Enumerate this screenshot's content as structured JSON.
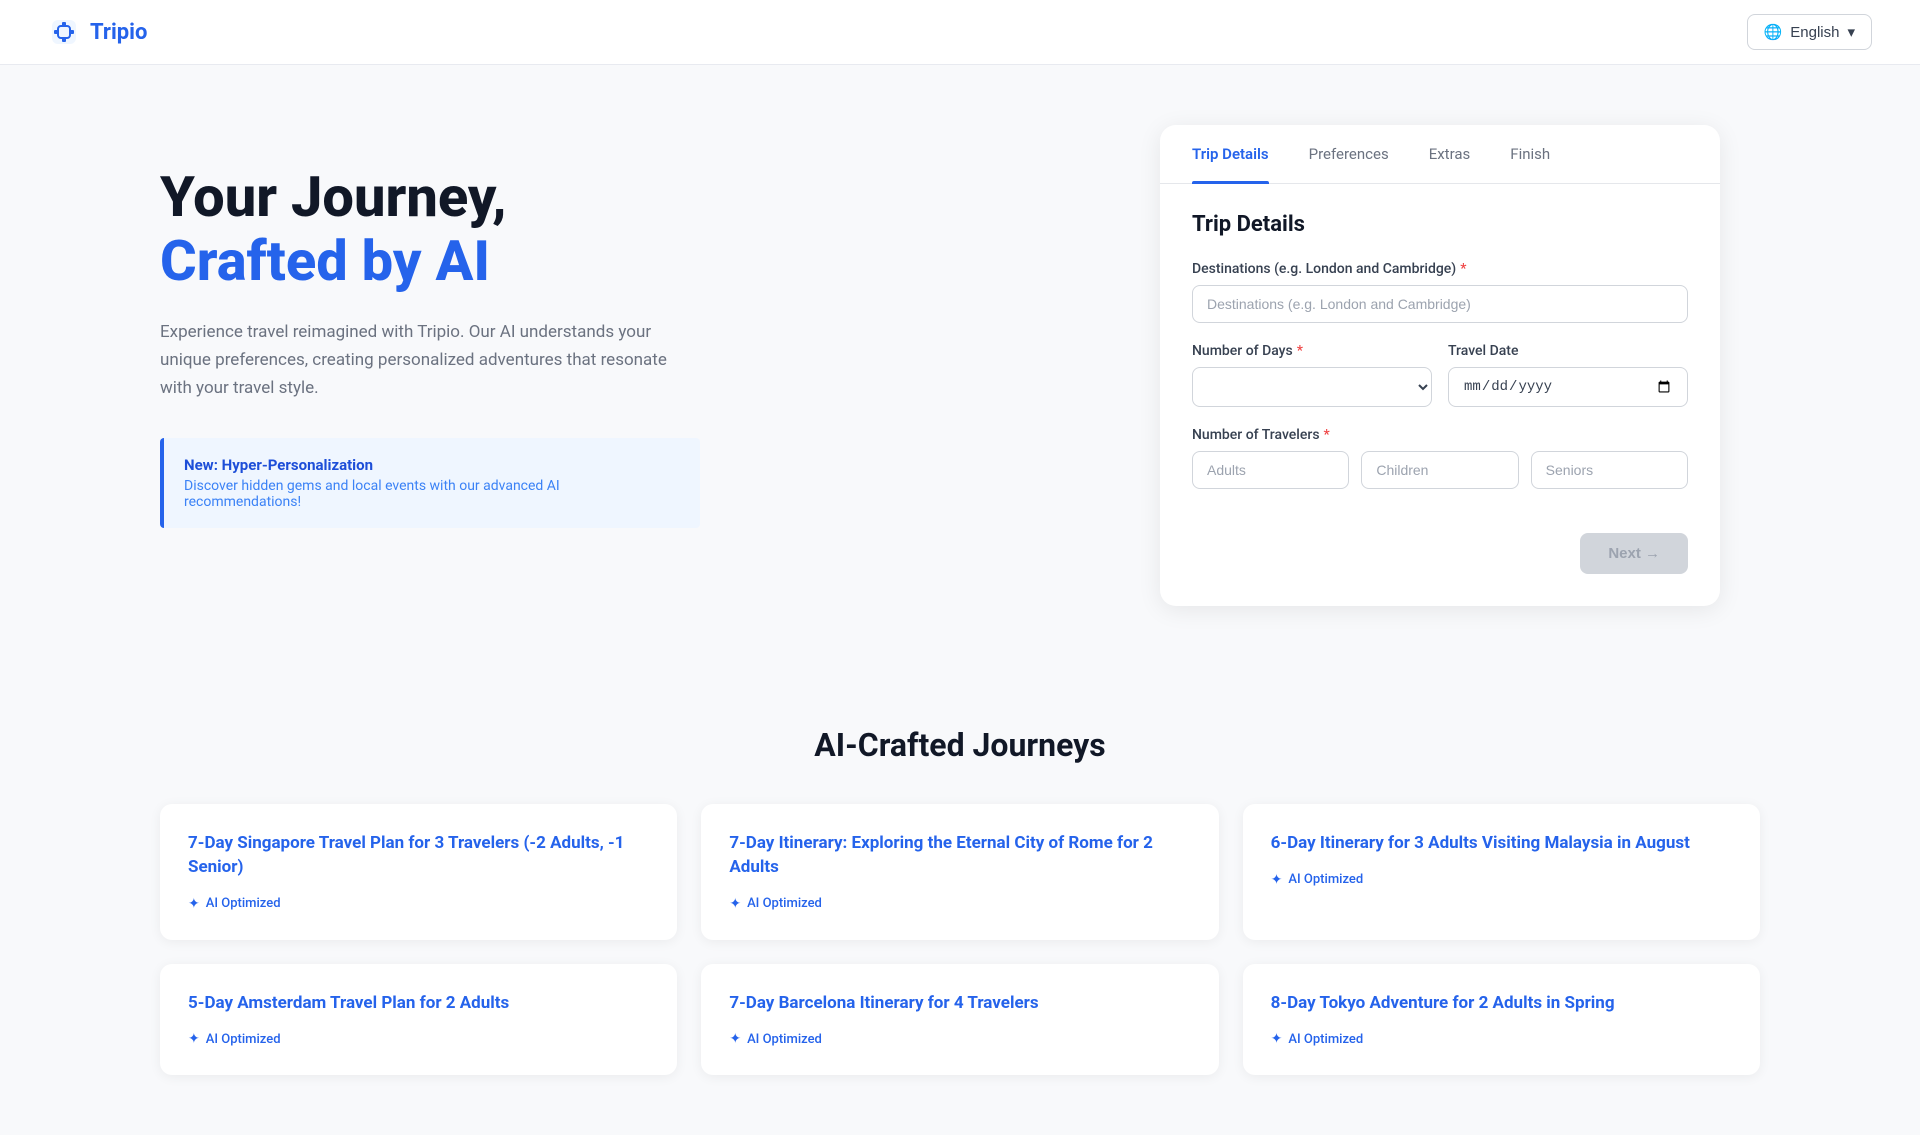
{
  "header": {
    "logo_text": "Tripio",
    "lang_label": "English",
    "lang_icon": "🌐"
  },
  "hero": {
    "title_line1": "Your Journey,",
    "title_line2": "Crafted by AI",
    "description": "Experience travel reimagined with Tripio. Our AI understands your unique preferences, creating personalized adventures that resonate with your travel style.",
    "promo_title": "New: Hyper-Personalization",
    "promo_desc": "Discover hidden gems and local events with our advanced AI recommendations!"
  },
  "trip_form": {
    "section_title": "Trip Details",
    "tabs": [
      {
        "id": "trip-details",
        "label": "Trip Details",
        "active": true
      },
      {
        "id": "preferences",
        "label": "Preferences",
        "active": false
      },
      {
        "id": "extras",
        "label": "Extras",
        "active": false
      },
      {
        "id": "finish",
        "label": "Finish",
        "active": false
      }
    ],
    "fields": {
      "destinations_label": "Destinations (e.g. London and Cambridge)",
      "destinations_placeholder": "Destinations (e.g. London and Cambridge)",
      "num_days_label": "Number of Days",
      "travel_date_label": "Travel Date",
      "travel_date_placeholder": "mm/dd/yyyy",
      "travelers_label": "Number of Travelers",
      "adults_placeholder": "Adults",
      "children_placeholder": "Children",
      "seniors_placeholder": "Seniors"
    },
    "next_button": "Next →"
  },
  "journeys": {
    "section_title": "AI-Crafted Journeys",
    "ai_badge_label": "AI Optimized",
    "cards": [
      {
        "title": "7-Day Singapore Travel Plan for 3 Travelers (-2 Adults, -1 Senior)",
        "badge": "AI Optimized"
      },
      {
        "title": "7-Day Itinerary: Exploring the Eternal City of Rome for 2 Adults",
        "badge": "AI Optimized"
      },
      {
        "title": "6-Day Itinerary for 3 Adults Visiting Malaysia in August",
        "badge": "AI Optimized"
      },
      {
        "title": "5-Day Amsterdam Travel Plan for 2 Adults",
        "badge": "AI Optimized"
      },
      {
        "title": "7-Day Barcelona Itinerary for 4 Travelers",
        "badge": "AI Optimized"
      },
      {
        "title": "8-Day Tokyo Adventure for 2 Adults in Spring",
        "badge": "AI Optimized"
      }
    ]
  }
}
